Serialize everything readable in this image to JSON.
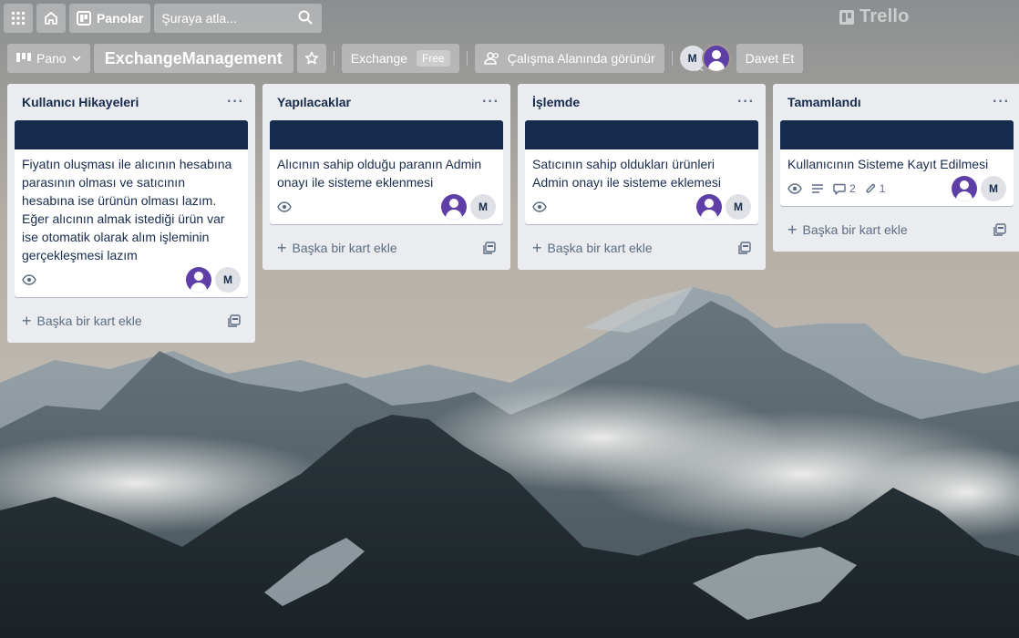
{
  "header": {
    "search_placeholder": "Şuraya atla...",
    "boards_label": "Panolar",
    "brand": "Trello"
  },
  "board": {
    "view_label": "Pano",
    "title": "ExchangeManagement",
    "workspace_name": "Exchange",
    "workspace_badge": "Free",
    "visibility_label": "Çalışma Alanında görünür",
    "member_initial": "M",
    "invite_label": "Davet Et"
  },
  "lists": [
    {
      "title": "Kullanıcı Hikayeleri",
      "add_card_label": "Başka bir kart ekle",
      "cards": [
        {
          "title": "Fiyatın oluşması ile alıcının hesabına parasının olması ve satıcının hesabına ise ürünün olması lazım. Eğer alıcının almak istediği ürün var ise otomatik olarak alım işleminin gerçekleşmesi lazım",
          "member_initial": "M"
        }
      ]
    },
    {
      "title": "Yapılacaklar",
      "add_card_label": "Başka bir kart ekle",
      "cards": [
        {
          "title": "Alıcının sahip olduğu paranın Admin onayı ile sisteme eklenmesi",
          "member_initial": "M"
        }
      ]
    },
    {
      "title": "İşlemde",
      "add_card_label": "Başka bir kart ekle",
      "cards": [
        {
          "title": "Satıcının sahip oldukları ürünleri Admin onayı ile sisteme eklemesi",
          "member_initial": "M"
        }
      ]
    },
    {
      "title": "Tamamlandı",
      "add_card_label": "Başka bir kart ekle",
      "cards": [
        {
          "title": "Kullanıcının Sisteme Kayıt Edilmesi",
          "member_initial": "M",
          "comments": "2",
          "attachments": "1"
        }
      ]
    }
  ],
  "colors": {
    "card_cover": "#172b4d",
    "list_bg": "#ebecf0",
    "avatar_purple": "#5e3fa8"
  },
  "icons": {
    "apps": "grid-icon",
    "home": "home-icon",
    "boards": "boards-icon",
    "search": "search-icon",
    "watch": "eye-icon",
    "description": "description-icon",
    "comments": "comment-icon",
    "attachments": "paperclip-icon",
    "template": "card-template-icon"
  }
}
